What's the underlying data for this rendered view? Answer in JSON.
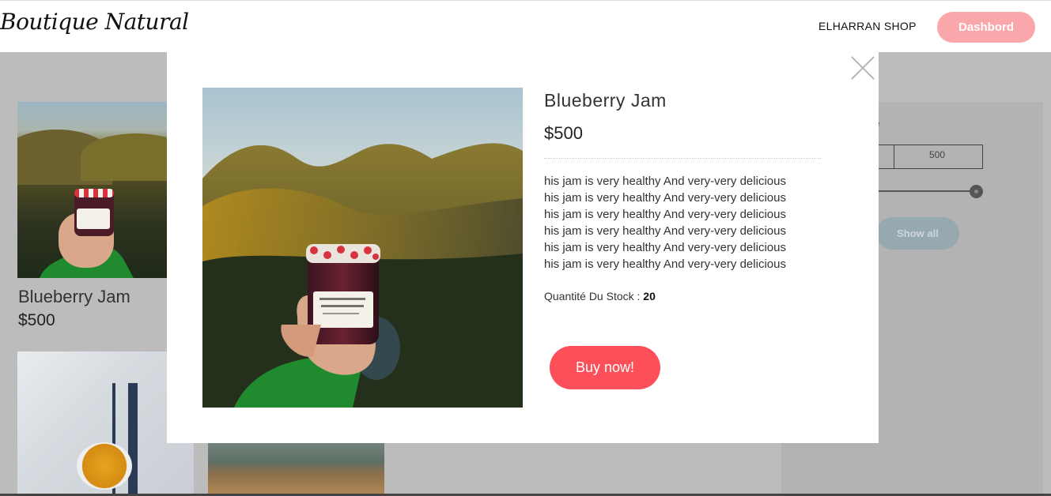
{
  "header": {
    "logo": "Boutique Natural",
    "nav_shop": "ELHARRAN SHOP",
    "dashboard_label": "Dashbord"
  },
  "background": {
    "products": [
      {
        "name": "Blueberry Jam",
        "price": "$500"
      }
    ],
    "sidebar": {
      "label_fragment": "e",
      "price_max": "500",
      "show_all_label": "Show all"
    }
  },
  "modal": {
    "title": "Blueberry Jam",
    "price": "$500",
    "description_lines": [
      "his jam is very healthy And very-very delicious",
      "his jam is very healthy And very-very delicious",
      "his jam is very healthy And very-very delicious",
      "his jam is very healthy And very-very delicious",
      "his jam is very healthy And very-very delicious",
      "his jam is very healthy And very-very delicious"
    ],
    "stock_label": "Quantité Du Stock : ",
    "stock_value": "20",
    "buy_label": "Buy now!"
  },
  "colors": {
    "dashboard_button": "#f9a7aa",
    "buy_button": "#fc4f5a",
    "overlay": "#bcbcbc"
  },
  "icons": {
    "close": "close-icon"
  }
}
